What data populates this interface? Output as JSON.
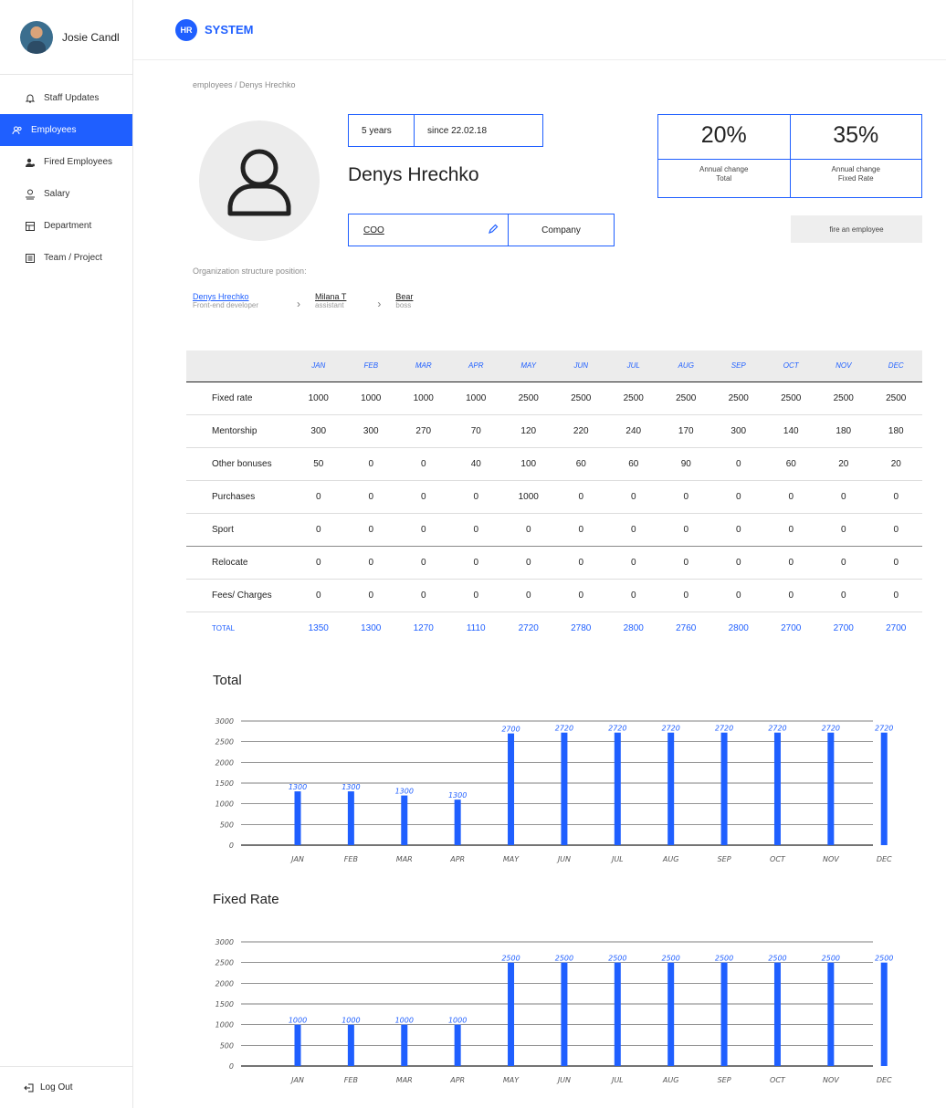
{
  "user": {
    "name": "Josie Candl"
  },
  "nav": [
    {
      "label": "Staff Updates",
      "icon": "bell-icon",
      "active": false
    },
    {
      "label": "Employees",
      "icon": "users-icon",
      "active": true
    },
    {
      "label": "Fired Employees",
      "icon": "user-fired-icon",
      "active": false
    },
    {
      "label": "Salary",
      "icon": "money-icon",
      "active": false
    },
    {
      "label": "Department",
      "icon": "building-icon",
      "active": false
    },
    {
      "label": "Team / Project",
      "icon": "list-icon",
      "active": false
    }
  ],
  "logout_label": "Log Out",
  "brand": {
    "badge": "HR",
    "name": "SYSTEM",
    "color": "#1f5fff"
  },
  "breadcrumb": "employees / Denys Hrechko",
  "employee": {
    "name": "Denys Hrechko",
    "tenure": "5 years",
    "since": "since 22.02.18",
    "role": "COO",
    "company": "Company"
  },
  "stats": [
    {
      "value": "20%",
      "label_line1": "Annual change",
      "label_line2": "Total"
    },
    {
      "value": "35%",
      "label_line1": "Annual change",
      "label_line2": "Fixed Rate"
    }
  ],
  "fire_button": "fire an employee",
  "org": {
    "label": "Organization structure position:",
    "nodes": [
      {
        "name": "Denys Hrechko",
        "role": "Front-end developer"
      },
      {
        "name": "Milana T",
        "role": "assistant"
      },
      {
        "name": "Bear",
        "role": "boss"
      }
    ]
  },
  "table": {
    "months": [
      "JAN",
      "FEB",
      "MAR",
      "APR",
      "MAY",
      "JUN",
      "JUL",
      "AUG",
      "SEP",
      "OCT",
      "NOV",
      "DEC"
    ],
    "rows": [
      {
        "label": "Fixed rate",
        "values": [
          "1000",
          "1000",
          "1000",
          "1000",
          "2500",
          "2500",
          "2500",
          "2500",
          "2500",
          "2500",
          "2500",
          "2500"
        ]
      },
      {
        "label": "Mentorship",
        "values": [
          "300",
          "300",
          "270",
          "70",
          "120",
          "220",
          "240",
          "170",
          "300",
          "140",
          "180",
          "180"
        ]
      },
      {
        "label": "Other bonuses",
        "values": [
          "50",
          "0",
          "0",
          "40",
          "100",
          "60",
          "60",
          "90",
          "0",
          "60",
          "20",
          "20"
        ]
      },
      {
        "label": "Purchases",
        "values": [
          "0",
          "0",
          "0",
          "0",
          "1000",
          "0",
          "0",
          "0",
          "0",
          "0",
          "0",
          "0"
        ]
      },
      {
        "label": "Sport",
        "values": [
          "0",
          "0",
          "0",
          "0",
          "0",
          "0",
          "0",
          "0",
          "0",
          "0",
          "0",
          "0"
        ]
      },
      {
        "label": "Relocate",
        "values": [
          "0",
          "0",
          "0",
          "0",
          "0",
          "0",
          "0",
          "0",
          "0",
          "0",
          "0",
          "0"
        ]
      },
      {
        "label": "Fees/ Charges",
        "values": [
          "0",
          "0",
          "0",
          "0",
          "0",
          "0",
          "0",
          "0",
          "0",
          "0",
          "0",
          "0"
        ]
      }
    ],
    "total": {
      "label": "TOTAL",
      "values": [
        "1350",
        "1300",
        "1270",
        "1110",
        "2720",
        "2780",
        "2800",
        "2760",
        "2800",
        "2700",
        "2700",
        "2700"
      ]
    }
  },
  "chart_data": [
    {
      "type": "bar",
      "title": "Total",
      "categories": [
        "JAN",
        "FEB",
        "MAR",
        "APR",
        "MAY",
        "JUN",
        "JUL",
        "AUG",
        "SEP",
        "OCT",
        "NOV",
        "DEC"
      ],
      "values": [
        1300,
        1300,
        1200,
        1100,
        2700,
        2720,
        2720,
        2720,
        2720,
        2720,
        2720,
        2720
      ],
      "value_labels": [
        "1300",
        "1300",
        "1300",
        "1300",
        "2700",
        "2720",
        "2720",
        "2720",
        "2720",
        "2720",
        "2720",
        "2720"
      ],
      "y_ticks": [
        "3000",
        "2500",
        "2000",
        "1500",
        "1000",
        "500",
        "0"
      ],
      "ylim": [
        0,
        3000
      ],
      "color": "#1f5fff",
      "grid": true
    },
    {
      "type": "bar",
      "title": "Fixed Rate",
      "categories": [
        "JAN",
        "FEB",
        "MAR",
        "APR",
        "MAY",
        "JUN",
        "JUL",
        "AUG",
        "SEP",
        "OCT",
        "NOV",
        "DEC"
      ],
      "values": [
        1000,
        1000,
        1000,
        1000,
        2500,
        2500,
        2500,
        2500,
        2500,
        2500,
        2500,
        2500
      ],
      "value_labels": [
        "1000",
        "1000",
        "1000",
        "1000",
        "2500",
        "2500",
        "2500",
        "2500",
        "2500",
        "2500",
        "2500",
        "2500"
      ],
      "y_ticks": [
        "3000",
        "2500",
        "2000",
        "1500",
        "1000",
        "500",
        "0"
      ],
      "ylim": [
        0,
        3000
      ],
      "color": "#1f5fff",
      "grid": true
    }
  ]
}
